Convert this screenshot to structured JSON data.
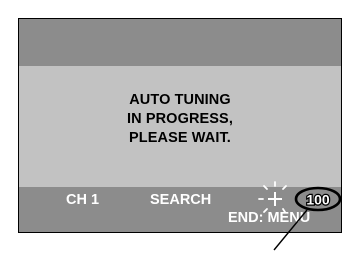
{
  "screen": {
    "message_lines": [
      "AUTO TUNING",
      "IN PROGRESS,",
      "PLEASE WAIT."
    ],
    "channel_label": "CH 1",
    "mode_label": "SEARCH",
    "progress_value": "100",
    "end_hint": "END: MENU"
  },
  "colors": {
    "background": "#8c8c8c",
    "message_panel": "#c2c2c2",
    "message_text": "#000000",
    "status_text": "#ffffff"
  },
  "icons": [
    "sparkle-plus-icon",
    "callout-circle",
    "callout-leader-line"
  ]
}
